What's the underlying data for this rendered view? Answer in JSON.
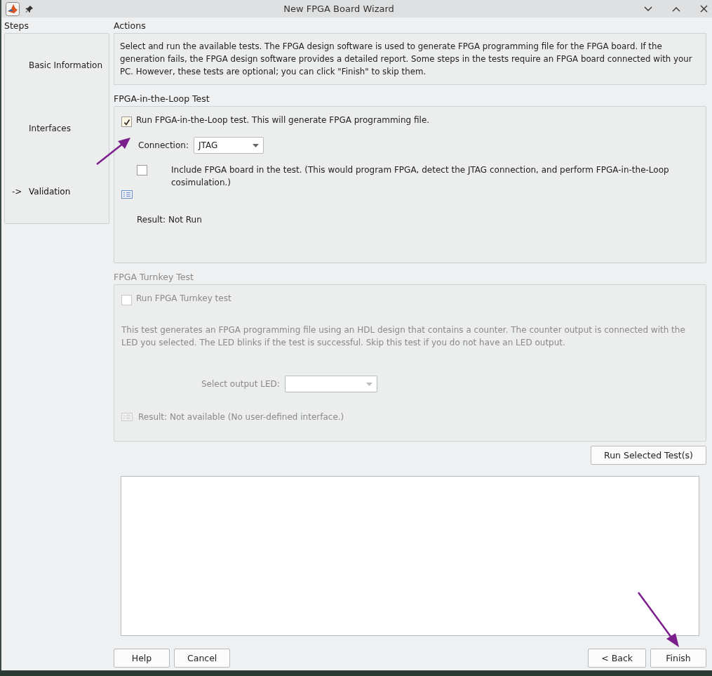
{
  "window": {
    "title": "New FPGA Board Wizard"
  },
  "steps": {
    "heading": "Steps",
    "marker": "->",
    "items": [
      {
        "label": "Basic Information",
        "selected": false
      },
      {
        "label": "Interfaces",
        "selected": false
      },
      {
        "label": "Validation",
        "selected": true
      }
    ]
  },
  "actions": {
    "heading": "Actions",
    "description": "Select and run the available tests. The FPGA design software is used to generate FPGA programming file for the FPGA board. If the generation fails, the FPGA design software provides a detailed report. Some steps in the tests require an FPGA board connected with your PC. However, these tests are optional; you can click \"Finish\" to skip them."
  },
  "fil_test": {
    "heading": "FPGA-in-the-Loop Test",
    "disabled": false,
    "run_checkbox": {
      "label": "Run FPGA-in-the-Loop test. This will generate FPGA programming file.",
      "checked": true
    },
    "connection": {
      "label": "Connection:",
      "value": "JTAG"
    },
    "include_checkbox": {
      "label": "Include FPGA board in the test. (This would program FPGA, detect the JTAG connection, and perform FPGA-in-the-Loop cosimulation.)",
      "checked": false
    },
    "result": "Result: Not Run"
  },
  "turnkey_test": {
    "heading": "FPGA Turnkey Test",
    "disabled": true,
    "run_checkbox": {
      "label": "Run FPGA Turnkey test",
      "checked": false
    },
    "description": "This test generates an FPGA programming file using an HDL design that contains a counter. The counter output is connected with the LED you selected. The LED blinks if the test is successful. Skip this test if you do not have an LED output.",
    "led": {
      "label": "Select output LED:"
    },
    "result": "Result: Not available (No user-defined interface.)"
  },
  "run_button": "Run Selected Test(s)",
  "left_buttons": [
    "Help",
    "Cancel"
  ],
  "right_buttons": [
    "< Back",
    "Finish"
  ]
}
